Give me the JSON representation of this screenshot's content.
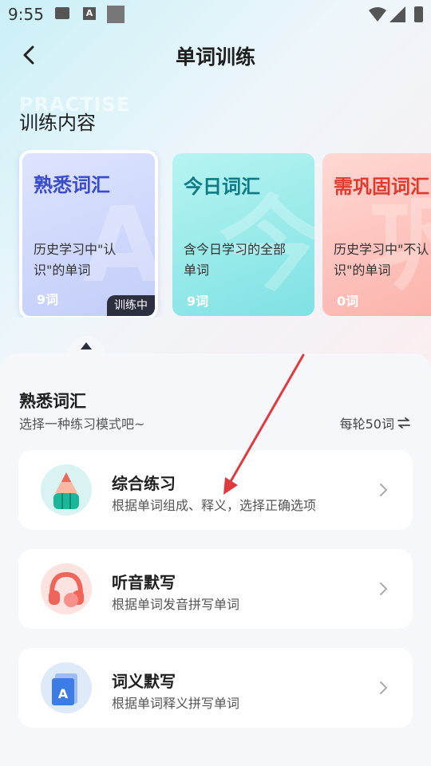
{
  "status_bar": {
    "time": "9:55",
    "a_icon_letter": "A"
  },
  "header": {
    "title": "单词训练",
    "watermark": "PRACTISE"
  },
  "section": {
    "title": "训练内容"
  },
  "cards": [
    {
      "title": "熟悉词汇",
      "desc": "历史学习中\"认识\"的单词",
      "count": "9词",
      "badge": "训练中",
      "deco": "A"
    },
    {
      "title": "今日词汇",
      "desc": "含今日学习的全部单词",
      "count": "9词",
      "deco": "今"
    },
    {
      "title": "需巩固词汇",
      "desc": "历史学习中\"不认识\"的单词",
      "count": "0词",
      "deco": "巩"
    }
  ],
  "sheet": {
    "title": "熟悉词汇",
    "subtitle": "选择一种练习模式吧~",
    "per_round": "每轮50词"
  },
  "modes": [
    {
      "name": "综合练习",
      "desc": "根据单词组成、释义，选择正确选项",
      "icon": "pencil-icon"
    },
    {
      "name": "听音默写",
      "desc": "根据单词发音拼写单词",
      "icon": "headphones-icon"
    },
    {
      "name": "词义默写",
      "desc": "根据单词释义拼写单词",
      "icon": "book-icon",
      "icon_letter": "A"
    }
  ],
  "colors": {
    "accent_blue": "#3b4bd0",
    "accent_teal": "#0e7a84",
    "accent_red": "#e03a2e",
    "annotation_arrow": "#e0393e"
  }
}
